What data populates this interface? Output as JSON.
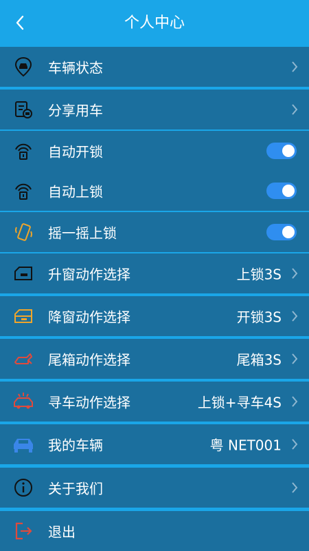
{
  "header": {
    "title": "个人中心"
  },
  "rows": [
    {
      "label": "车辆状态",
      "value": "",
      "control": "chevron",
      "icon": "car-status-icon"
    },
    {
      "label": "分享用车",
      "value": "",
      "control": "chevron",
      "icon": "share-car-icon"
    },
    {
      "label": "自动开锁",
      "value": "",
      "control": "toggle",
      "on": true,
      "icon": "auto-unlock-icon"
    },
    {
      "label": "自动上锁",
      "value": "",
      "control": "toggle",
      "on": true,
      "icon": "auto-lock-icon"
    },
    {
      "label": "摇一摇上锁",
      "value": "",
      "control": "toggle",
      "on": true,
      "icon": "shake-lock-icon"
    },
    {
      "label": "升窗动作选择",
      "value": "上锁3S",
      "control": "chevron",
      "icon": "window-up-icon"
    },
    {
      "label": "降窗动作选择",
      "value": "开锁3S",
      "control": "chevron",
      "icon": "window-down-icon"
    },
    {
      "label": "尾箱动作选择",
      "value": "尾箱3S",
      "control": "chevron",
      "icon": "trunk-icon"
    },
    {
      "label": "寻车动作选择",
      "value": "上锁+寻车4S",
      "control": "chevron",
      "icon": "find-car-icon"
    },
    {
      "label": "我的车辆",
      "value": "粤 NET001",
      "control": "chevron",
      "icon": "my-car-icon"
    },
    {
      "label": "关于我们",
      "value": "",
      "control": "chevron",
      "icon": "info-icon"
    },
    {
      "label": "退出",
      "value": "",
      "control": "none",
      "icon": "logout-icon"
    }
  ],
  "colors": {
    "header": "#1aa6e8",
    "row": "#1b6f9e",
    "toggle_on": "#2f8ef0",
    "orange": "#f0a52a",
    "red": "#e04a3c",
    "blue": "#3a86e8"
  }
}
